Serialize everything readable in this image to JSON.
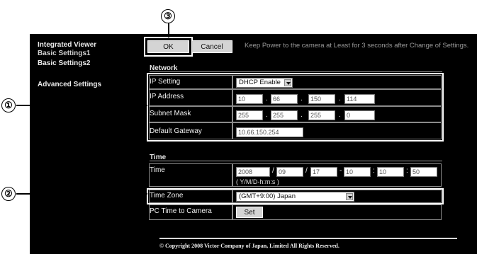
{
  "sidebar": {
    "items": [
      {
        "label": "Integrated Viewer"
      },
      {
        "label": "Basic Settings1"
      },
      {
        "label": "Basic Settings2"
      },
      {
        "label": "Advanced Settings"
      }
    ]
  },
  "toolbar": {
    "ok_label": "OK",
    "cancel_label": "Cancel",
    "notice": "Keep Power to the camera at Least for 3 seconds after Change of Settings."
  },
  "network": {
    "title": "Network",
    "ip_setting_label": "IP Setting",
    "ip_setting_value": "DHCP Enable",
    "ip_address_label": "IP Address",
    "ip_address": [
      "10",
      "66",
      "150",
      "114"
    ],
    "subnet_mask_label": "Subnet Mask",
    "subnet_mask": [
      "255",
      "255",
      "255",
      "0"
    ],
    "gateway_label": "Default Gateway",
    "gateway_value": "10.66.150.254"
  },
  "time": {
    "title": "Time",
    "time_label": "Time",
    "date_values": [
      "2008",
      "09",
      "17"
    ],
    "time_values": [
      "10",
      "10",
      "50"
    ],
    "format_hint": "( Y/M/D-h:m:s )",
    "timezone_label": "Time Zone",
    "timezone_value": "(GMT+9:00) Japan",
    "pc_time_label": "PC Time to Camera",
    "set_label": "Set"
  },
  "callouts": [
    "①",
    "②",
    "③"
  ],
  "footer": {
    "copyright": "© Copyright 2008 Victor Company of Japan, Limited All Rights Reserved."
  }
}
